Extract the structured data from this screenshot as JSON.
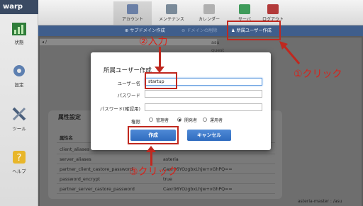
{
  "app": {
    "logo": "warp"
  },
  "sidebar": {
    "items": [
      {
        "label": "状態",
        "icon": "chart-icon"
      },
      {
        "label": "設定",
        "icon": "gear-icon"
      },
      {
        "label": "ツール",
        "icon": "tools-icon"
      },
      {
        "label": "ヘルプ",
        "icon": "help-icon"
      }
    ]
  },
  "topnav": {
    "tabs": [
      {
        "label": "アカウント",
        "active": true
      },
      {
        "label": "メンテナンス"
      },
      {
        "label": "カレンダー"
      },
      {
        "label": "サーバ"
      },
      {
        "label": "ログアウト"
      }
    ]
  },
  "subbar": {
    "items": [
      "サブドメイン作成",
      "ドメインの削除",
      "所属ユーザー作成"
    ]
  },
  "tree": {
    "path": "/",
    "items": [
      "asu",
      "guest"
    ]
  },
  "properties": {
    "title": "属性設定",
    "header": "属性名",
    "rows": [
      {
        "key": "client_aliases",
        "value": ""
      },
      {
        "key": "server_aliases",
        "value": "asteria"
      },
      {
        "key": "partner_client_castore_password",
        "value": "Caxr06YOzgbxLhjw+vGhPQ=="
      },
      {
        "key": "password_encrypt",
        "value": "true"
      },
      {
        "key": "partner_server_castore_password",
        "value": "Caxr06YOzgbxLhjw+vGhPQ=="
      }
    ]
  },
  "dialog": {
    "title": "所属ユーザー作成",
    "user_label": "ユーザー名",
    "user_value": "startup",
    "password_label": "パスワード",
    "password_confirm_label": "パスワード(確認用)",
    "role_label": "権限",
    "roles": [
      {
        "label": "管理者",
        "selected": false
      },
      {
        "label": "開発者",
        "selected": true
      },
      {
        "label": "運用者",
        "selected": false
      }
    ],
    "create_button": "作成",
    "cancel_button": "キャンセル"
  },
  "annotations": {
    "step1": "①クリック",
    "step2": "②入力",
    "step3": "③クリック"
  },
  "footer": {
    "path": "asteria-master : /asu"
  },
  "colors": {
    "accent": "#c0281f",
    "nav": "#3f5e8c",
    "button": "#2f6bbf"
  }
}
